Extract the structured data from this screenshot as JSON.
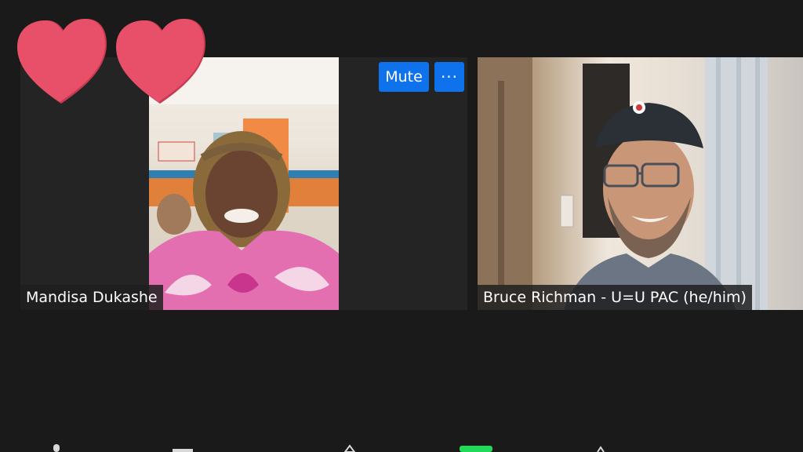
{
  "participants": [
    {
      "name": "Mandisa Dukashe"
    },
    {
      "name": "Bruce Richman - U=U PAC  (he/him)"
    }
  ],
  "tile_controls": {
    "mute_label": "Mute",
    "more_label": "···"
  },
  "reaction": {
    "icon": "heart-icon",
    "count": 2,
    "color": "#e8506a"
  },
  "colors": {
    "background": "#1a1a1a",
    "tile": "#242424",
    "accent_blue": "#0e72ed",
    "video_on_green": "#23d959"
  },
  "toolbar_icons": [
    "microphone-icon",
    "video-icon",
    "security-icon",
    "participants-icon",
    "chat-icon"
  ]
}
